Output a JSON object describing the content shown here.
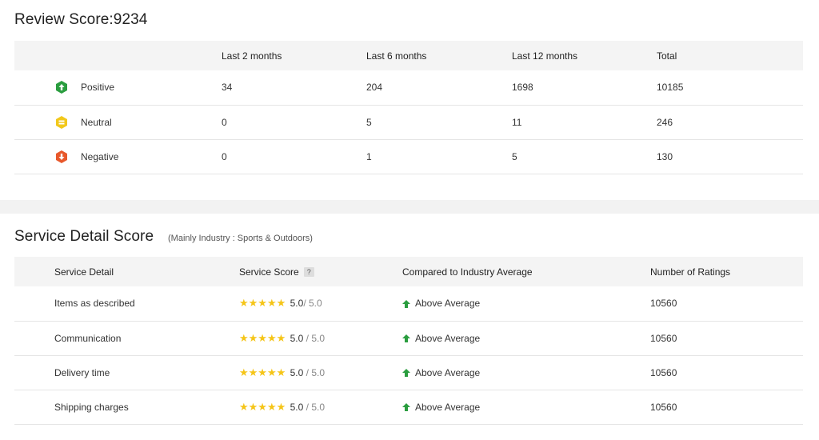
{
  "review": {
    "title": "Review Score:9234",
    "columns": [
      "",
      "Last 2 months",
      "Last 6 months",
      "Last 12 months",
      "Total"
    ],
    "rows": [
      {
        "type": "Positive",
        "icon": "positive-up-icon",
        "color": "#2a9d3f",
        "values": [
          "34",
          "204",
          "1698",
          "10185"
        ]
      },
      {
        "type": "Neutral",
        "icon": "neutral-equal-icon",
        "color": "#f2c81b",
        "values": [
          "0",
          "5",
          "11",
          "246"
        ]
      },
      {
        "type": "Negative",
        "icon": "negative-down-icon",
        "color": "#e8582b",
        "values": [
          "0",
          "1",
          "5",
          "130"
        ]
      }
    ]
  },
  "service": {
    "title": "Service Detail Score",
    "note": "(Mainly Industry : Sports & Outdoors)",
    "columns": [
      "Service Detail",
      "Service Score",
      "Compared to Industry Average",
      "Number of Ratings"
    ],
    "help_badge": "?",
    "rows": [
      {
        "detail": "Items as described",
        "stars": 5,
        "score": "5.0",
        "max": "/ 5.0",
        "compared": "Above Average",
        "ratings": "10560"
      },
      {
        "detail": "Communication",
        "stars": 5,
        "score": "5.0",
        "max": " / 5.0",
        "compared": "Above Average",
        "ratings": "10560"
      },
      {
        "detail": "Delivery time",
        "stars": 5,
        "score": "5.0",
        "max": " / 5.0",
        "compared": "Above Average",
        "ratings": "10560"
      },
      {
        "detail": "Shipping charges",
        "stars": 5,
        "score": "5.0",
        "max": " / 5.0",
        "compared": "Above Average",
        "ratings": "10560"
      }
    ]
  },
  "colors": {
    "star": "#f5c518",
    "above_average_arrow": "#2a9d3f"
  }
}
